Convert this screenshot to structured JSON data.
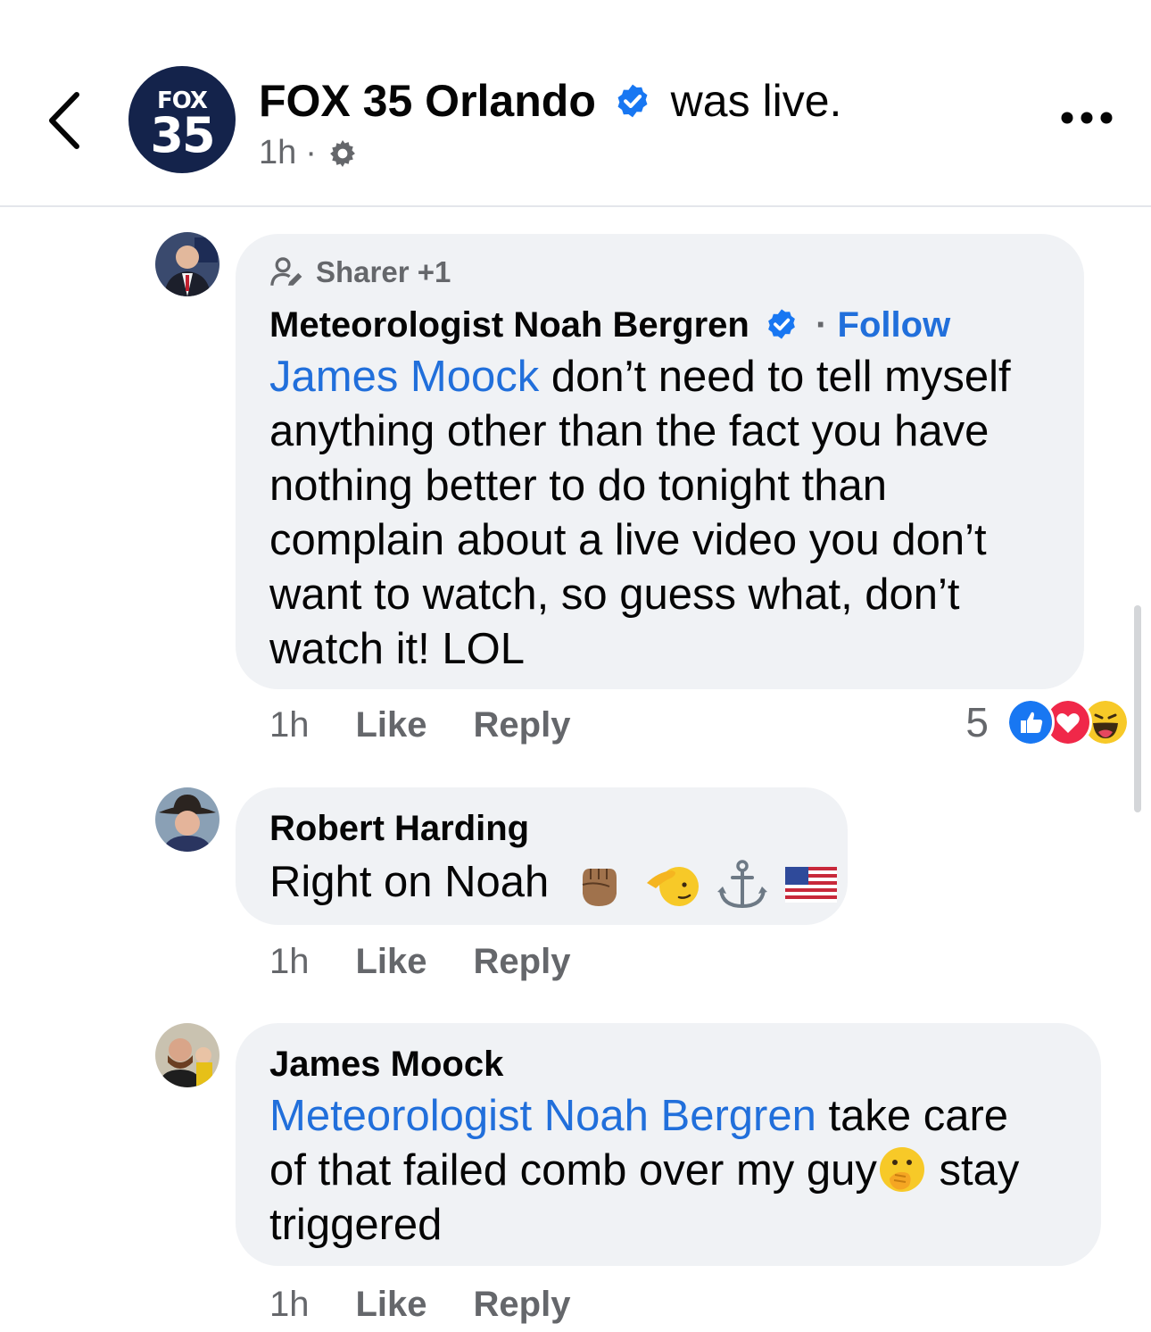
{
  "header": {
    "avatar_top": "FOX",
    "avatar_num": "35",
    "page_name": "FOX 35 Orlando",
    "status_text": "was live.",
    "time": "1h",
    "separator": "·"
  },
  "comments": [
    {
      "badge_label": "Sharer +1",
      "author": "Meteorologist Noah Bergren",
      "follow_sep": "·",
      "follow_label": "Follow",
      "mention": "James Moock",
      "text_lines": [
        " don’t need to tell myself",
        "anything other than the fact you have",
        "nothing better to do tonight than",
        "complain about a live video you don’t",
        "want to watch, so guess what, don’t",
        "watch it! LOL"
      ],
      "time": "1h",
      "like_label": "Like",
      "reply_label": "Reply",
      "reaction_count": "5",
      "reactions": [
        "like-icon",
        "love-icon",
        "haha-icon"
      ]
    },
    {
      "author": "Robert Harding",
      "text": "Right on Noah",
      "emojis": [
        "raised-fist-icon",
        "saluting-face-icon",
        "anchor-icon",
        "us-flag-icon"
      ],
      "time": "1h",
      "like_label": "Like",
      "reply_label": "Reply"
    },
    {
      "author": "James Moock",
      "mention": "Meteorologist Noah Bergren",
      "text_line1": " take care",
      "text_line2a": "of that failed comb over my guy",
      "text_line2b": " stay",
      "text_line3": "triggered",
      "emoji": "face-with-hand-over-mouth-icon",
      "time": "1h",
      "like_label": "Like",
      "reply_label": "Reply"
    }
  ],
  "colors": {
    "link": "#216fdb",
    "bubble": "#f0f2f5",
    "secondary_text": "#65676b",
    "verified": "#1877f2",
    "page_avatar_bg": "#14234b"
  }
}
